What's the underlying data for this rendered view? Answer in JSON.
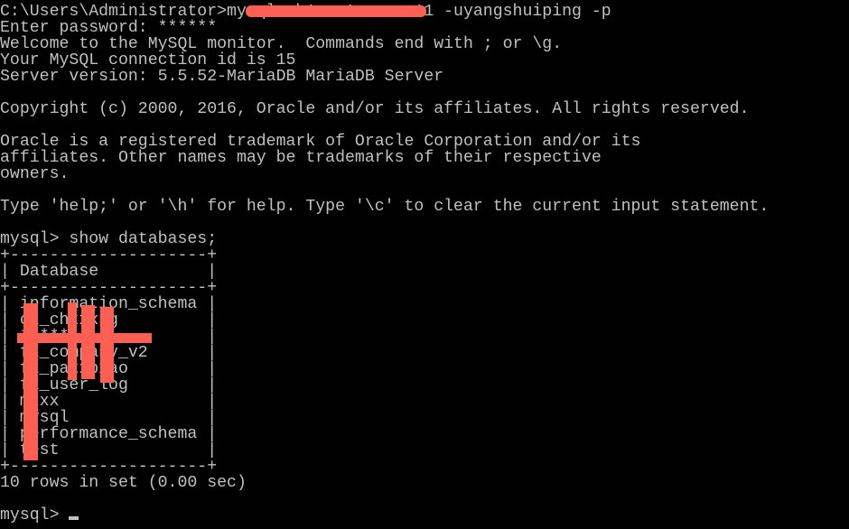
{
  "colors": {
    "background": "#000000",
    "text": "#c0c0c0",
    "redaction": "#ff5f52"
  },
  "console": {
    "command": "C:\\Users\\Administrator>mysql -h1xx.1xx.xx.11 -uyangshuiping -p",
    "password_prompt": "Enter password: ******",
    "welcome": "Welcome to the MySQL monitor.  Commands end with ; or \\g.",
    "connection_id": "Your MySQL connection id is 15",
    "server_version": "Server version: 5.5.52-MariaDB MariaDB Server",
    "copyright": "Copyright (c) 2000, 2016, Oracle and/or its affiliates. All rights reserved.",
    "trademark_1": "Oracle is a registered trademark of Oracle Corporation and/or its",
    "trademark_2": "affiliates. Other names may be trademarks of their respective",
    "trademark_3": "owners.",
    "help": "Type 'help;' or '\\h' for help. Type '\\c' to clear the current input statement.",
    "query": "mysql> show databases;",
    "table": {
      "border": "+--------------------+",
      "header": "| Database           |",
      "rows": [
        "| information_schema |",
        "| cx_chxxxng         |",
        "| ******             |",
        "| fx_company_v2      |",
        "| fx_paxxpxao        |",
        "| fx_user_log        |",
        "| mxxx               |",
        "| mysql              |",
        "| performance_schema |",
        "| test               |"
      ]
    },
    "result": "10 rows in set (0.00 sec)",
    "prompt": "mysql> "
  }
}
